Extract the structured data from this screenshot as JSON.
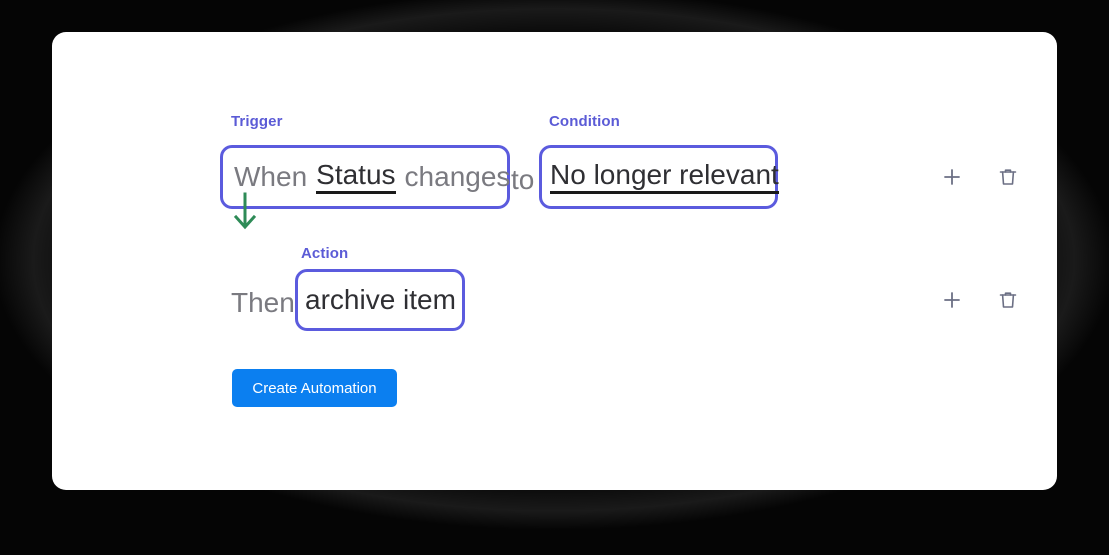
{
  "theme": {
    "card_background": "#ffffff",
    "backdrop": "#000000",
    "highlight_border": "#5b5bde",
    "label_color": "#5b5bd6",
    "static_text_color": "#7a7a80",
    "value_text_color": "#2f2f33",
    "arrow_color": "#2e8b57",
    "primary_button_background": "#0b7ff0",
    "icon_color": "#6b6f84"
  },
  "automation": {
    "rows": [
      {
        "id": "trigger-row",
        "labels": {
          "trigger": "Trigger",
          "condition": "Condition"
        },
        "when_word": "When",
        "trigger_field": "Status",
        "changes_word": "changes",
        "to_word": "to",
        "condition_value": "No longer relevant",
        "add_icon": "plus-icon",
        "delete_icon": "trash-icon"
      },
      {
        "id": "action-row",
        "labels": {
          "action": "Action"
        },
        "then_word": "Then",
        "action_value": "archive item",
        "add_icon": "plus-icon",
        "delete_icon": "trash-icon"
      }
    ],
    "flow_arrow": "down-arrow-icon",
    "create_button_label": "Create Automation"
  }
}
